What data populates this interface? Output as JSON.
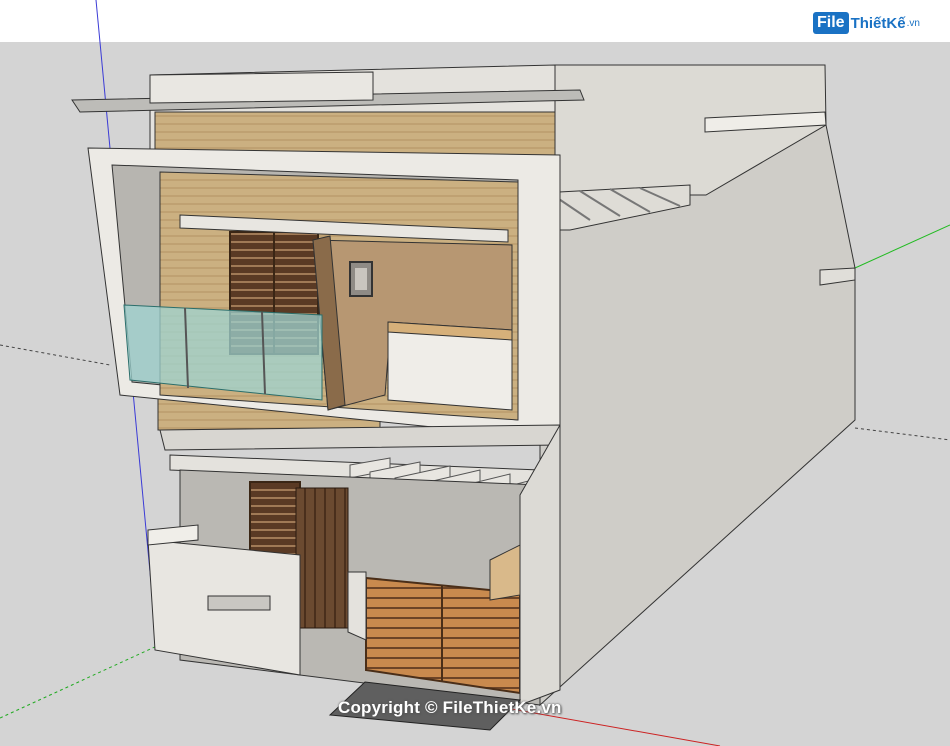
{
  "watermark": {
    "logo_file": "File",
    "logo_rest": "ThiếtKế",
    "logo_domain": ".vn",
    "copyright": "Copyright © FileThietKe.vn"
  },
  "colors": {
    "sky": "#ffffff",
    "ground": "#d4d4d4",
    "wall_white": "#e4e2dd",
    "wall_side": "#cfcdc8",
    "wood": "#c9a66b",
    "wood_dark": "#6e4a2a",
    "glass": "#9fd4d2",
    "axis_blue": "#3b3bd6",
    "axis_green": "#22bb22",
    "axis_red": "#cc2222",
    "logo_blue": "#1a72c4"
  },
  "icons": {
    "logo": "filethietke-logo-icon"
  }
}
